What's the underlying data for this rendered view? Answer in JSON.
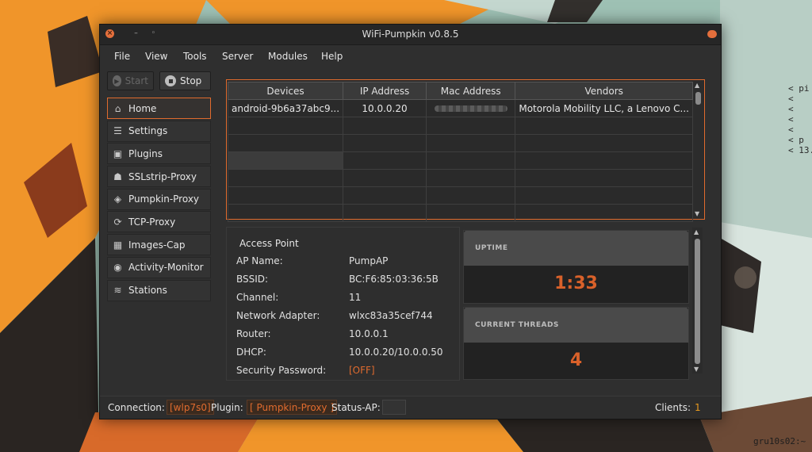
{
  "window": {
    "title": "WiFi-Pumpkin v0.8.5"
  },
  "menu": [
    "File",
    "View",
    "Tools",
    "Server",
    "Modules",
    "Help"
  ],
  "toolbar": {
    "start_label": "Start",
    "stop_label": "Stop"
  },
  "sidebar": {
    "items": [
      {
        "label": "Home",
        "icon": "home-icon"
      },
      {
        "label": "Settings",
        "icon": "settings-icon"
      },
      {
        "label": "Plugins",
        "icon": "plugins-icon"
      },
      {
        "label": "SSLstrip-Proxy",
        "icon": "sslstrip-icon"
      },
      {
        "label": "Pumpkin-Proxy",
        "icon": "pumpkin-proxy-icon"
      },
      {
        "label": "TCP-Proxy",
        "icon": "tcp-proxy-icon"
      },
      {
        "label": "Images-Cap",
        "icon": "images-cap-icon"
      },
      {
        "label": "Activity-Monitor",
        "icon": "eye-icon"
      },
      {
        "label": "Stations",
        "icon": "wifi-icon"
      }
    ],
    "active": "Home"
  },
  "devices_table": {
    "columns": [
      "Devices",
      "IP Address",
      "Mac Address",
      "Vendors"
    ],
    "rows": [
      {
        "device": "android-9b6a37abc9...",
        "ip": "10.0.0.20",
        "mac": "",
        "vendor": "Motorola Mobility LLC, a Lenovo C..."
      }
    ]
  },
  "access_point": {
    "title": "Access Point",
    "fields": [
      {
        "label": "AP Name:",
        "value": "PumpAP"
      },
      {
        "label": "BSSID:",
        "value": "BC:F6:85:03:36:5B"
      },
      {
        "label": "Channel:",
        "value": "11"
      },
      {
        "label": "Network Adapter:",
        "value": "wlxc83a35cef744"
      },
      {
        "label": "Router:",
        "value": "10.0.0.1"
      },
      {
        "label": "DHCP:",
        "value": "10.0.0.20/10.0.0.50"
      },
      {
        "label": "Security Password:",
        "value": "[OFF]"
      }
    ]
  },
  "cards": {
    "uptime": {
      "label": "UPTIME",
      "value": "1:33"
    },
    "threads": {
      "label": "CURRENT THREADS",
      "value": "4"
    }
  },
  "statusbar": {
    "connection_label": "Connection:",
    "connection_value": "[wlp7s0]",
    "plugin_label": "Plugin:",
    "plugin_value": "[ Pumpkin-Proxy ]",
    "status_ap_label": "Status-AP:",
    "clients_label": "Clients:",
    "clients_value": "1"
  },
  "desktop": {
    "terminal_lines": [
      "< pi",
      "< ",
      "< ",
      "< ",
      "< ",
      "< p",
      "< 13."
    ],
    "hostname": "gru10s02:~"
  },
  "colors": {
    "accent": "#e06b2e",
    "window_bg": "#2f2f2f",
    "orange_wall": "#f0952a",
    "mint_wall": "#9ec1b4"
  }
}
